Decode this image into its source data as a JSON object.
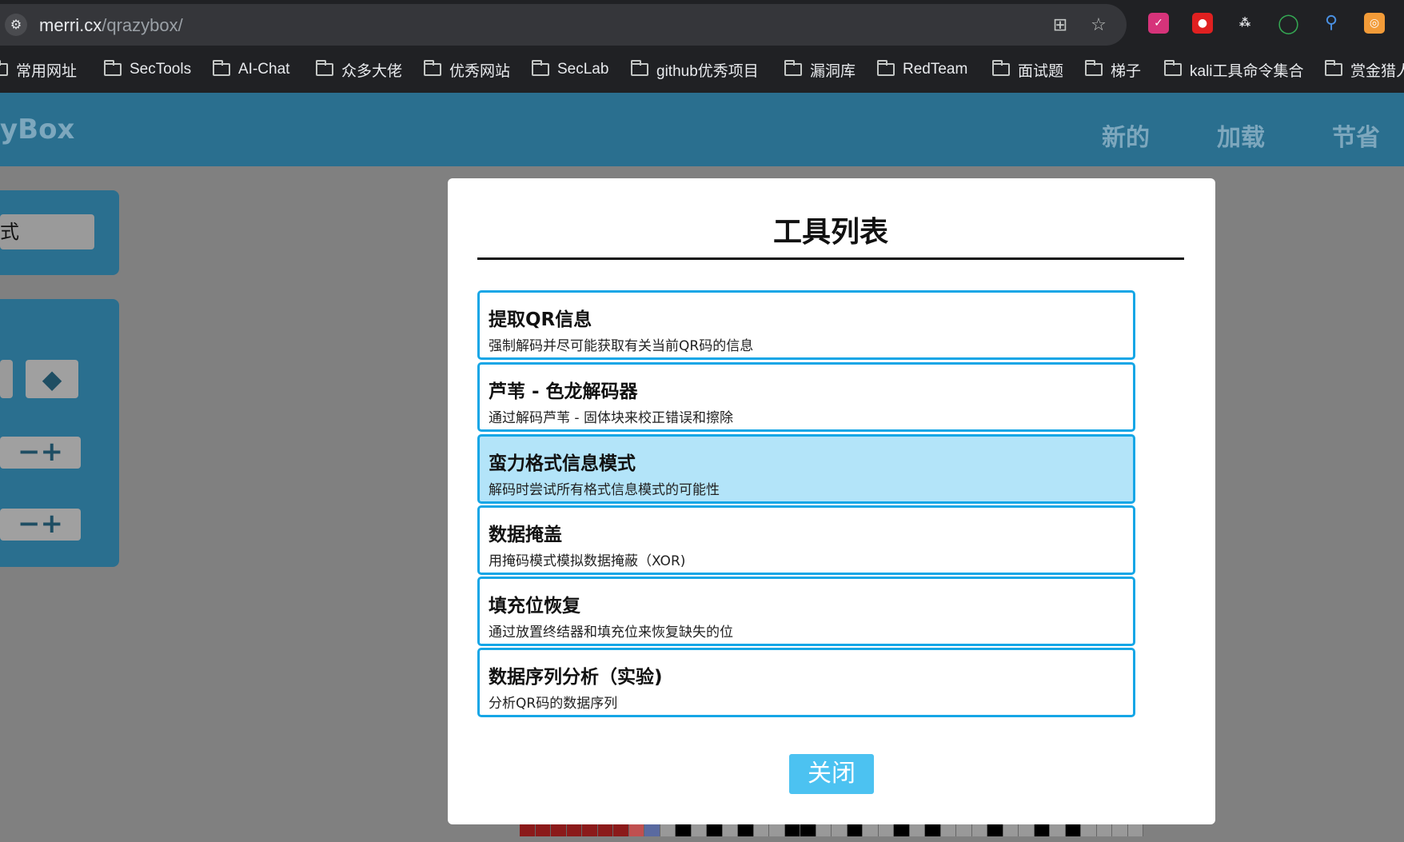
{
  "browser": {
    "url_host": "merri.cx",
    "url_path": "/qrazybox/",
    "bookmarks": [
      "常用网址",
      "SecTools",
      "AI-Chat",
      "众多大佬",
      "优秀网站",
      "SecLab",
      "github优秀项目",
      "漏洞库",
      "RedTeam",
      "面试题",
      "梯子",
      "kali工具命令集合",
      "赏金猎人"
    ]
  },
  "app": {
    "logo": "yBox",
    "nav": [
      "新的",
      "加载",
      "节省"
    ],
    "left_field_text": "式"
  },
  "modal": {
    "title": "工具列表",
    "tools": [
      {
        "name": "提取QR信息",
        "desc": "强制解码并尽可能获取有关当前QR码的信息"
      },
      {
        "name": "芦苇 - 色龙解码器",
        "desc": "通过解码芦苇 - 固体块来校正错误和擦除"
      },
      {
        "name": "蛮力格式信息模式",
        "desc": "解码时尝试所有格式信息模式的可能性"
      },
      {
        "name": "数据掩盖",
        "desc": "用掩码模式模拟数据掩蔽（XOR)"
      },
      {
        "name": "填充位恢复",
        "desc": "通过放置终结器和填充位来恢复缺失的位"
      },
      {
        "name": "数据序列分析（实验)",
        "desc": "分析QR码的数据序列"
      }
    ],
    "active_index": 2,
    "close_label": "关闭"
  },
  "colors": {
    "accent": "#15a6e6",
    "header": "#2a6f8f",
    "active_row": "#b3e4f9",
    "close_button": "#4cc2f1"
  }
}
